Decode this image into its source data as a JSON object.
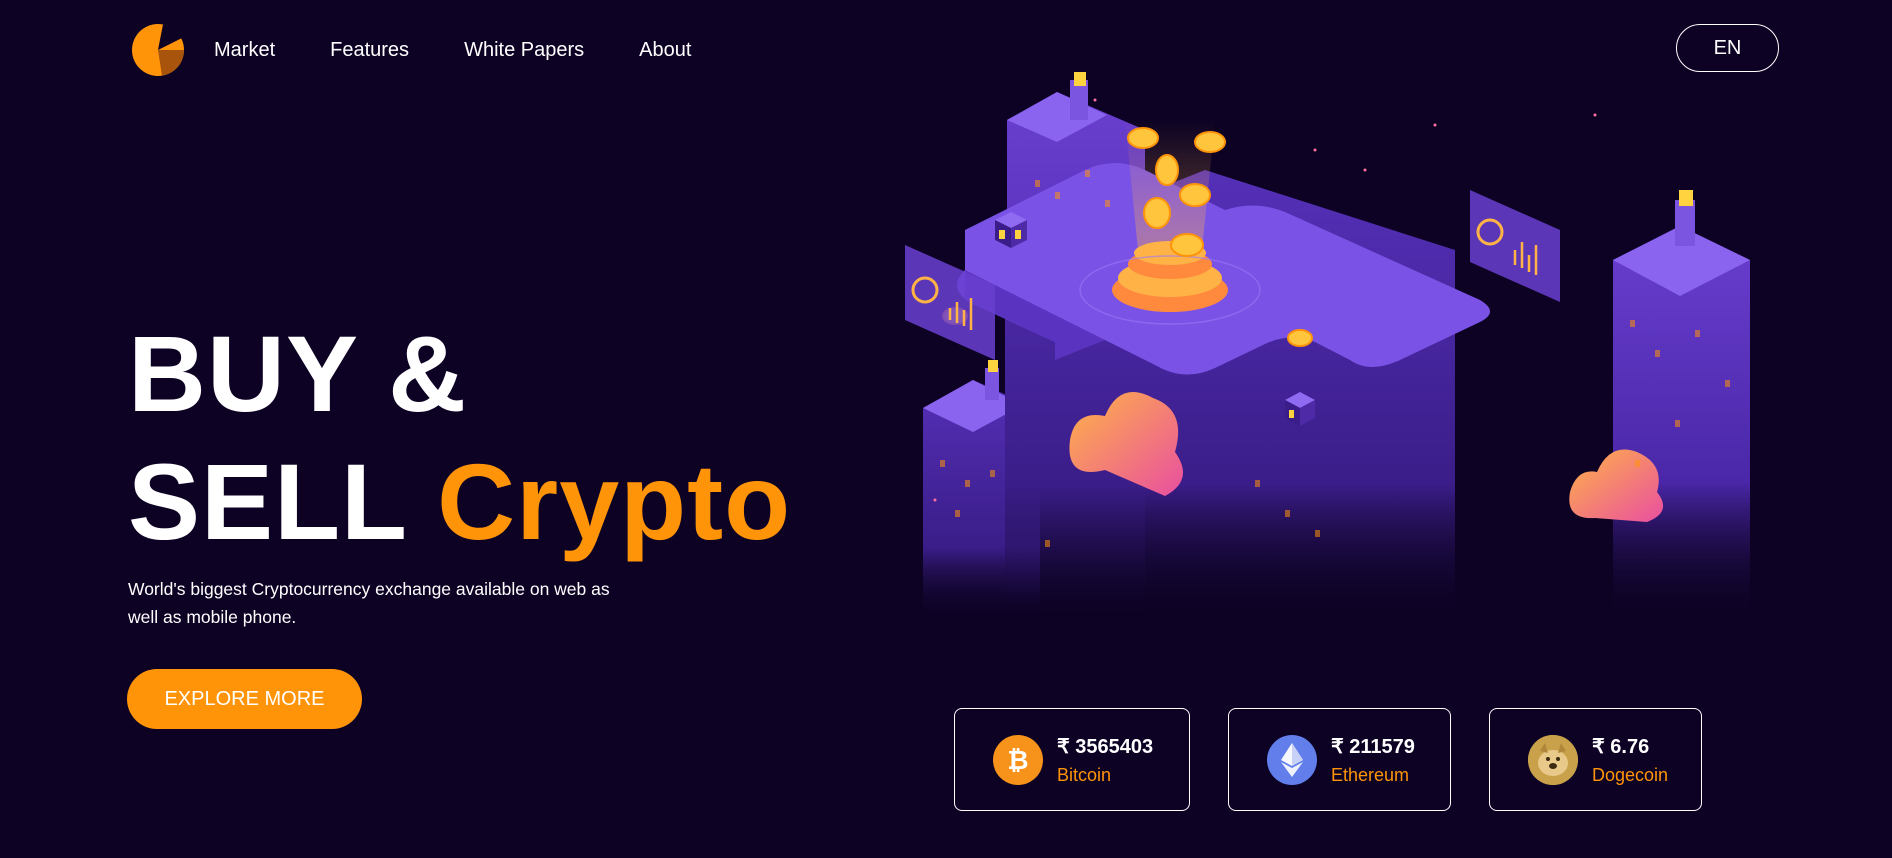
{
  "nav": {
    "items": [
      {
        "label": "Market"
      },
      {
        "label": "Features"
      },
      {
        "label": "White Papers"
      },
      {
        "label": "About"
      }
    ],
    "language": "EN"
  },
  "hero": {
    "title_line1": "BUY &",
    "title_line2_plain": "SELL",
    "title_line2_accent": "Crypto",
    "subtitle": "World's biggest Cryptocurrency exchange available on web as well as mobile phone.",
    "cta_label": "EXPLORE MORE"
  },
  "prices": [
    {
      "price": "₹ 3565403",
      "name": "Bitcoin",
      "icon": "bitcoin-icon"
    },
    {
      "price": "₹ 211579",
      "name": "Ethereum",
      "icon": "ethereum-icon"
    },
    {
      "price": "₹ 6.76",
      "name": "Dogecoin",
      "icon": "dogecoin-icon"
    }
  ],
  "colors": {
    "background": "#0d0224",
    "accent": "#ff9408",
    "illustration_purple": "#6a3fd0",
    "bitcoin": "#f7931a",
    "ethereum": "#627eea"
  }
}
